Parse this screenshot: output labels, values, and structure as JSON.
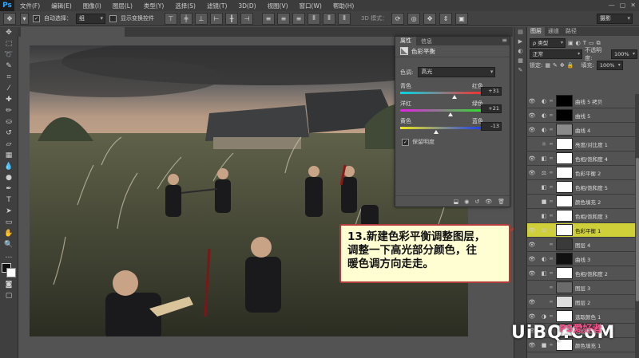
{
  "app": {
    "logo": "Ps"
  },
  "menubar": {
    "items": [
      "文件(F)",
      "编辑(E)",
      "图像(I)",
      "图层(L)",
      "类型(Y)",
      "选择(S)",
      "滤镜(T)",
      "3D(D)",
      "视图(V)",
      "窗口(W)",
      "帮助(H)"
    ],
    "win_controls": [
      "—",
      "▢",
      "✕"
    ]
  },
  "options": {
    "auto_select_label": "自动选择：",
    "auto_select_value": "组",
    "show_transform_label": "显示变换控件",
    "mode_3d_label": "3D 模式：",
    "workspace": "摄影"
  },
  "properties_panel": {
    "tabs": [
      "属性",
      "信息"
    ],
    "title": "色彩平衡",
    "tone_label": "色调:",
    "tone_value": "高光",
    "sliders": [
      {
        "left": "青色",
        "right": "红色",
        "value": "+31",
        "level": 0.655
      },
      {
        "left": "洋红",
        "right": "绿色",
        "value": "+21",
        "level": 0.605
      },
      {
        "left": "黄色",
        "right": "蓝色",
        "value": "-13",
        "level": 0.435
      }
    ],
    "preserve_label": "保留明度",
    "preserve_checked": "✓"
  },
  "layers_panel": {
    "tabs": [
      "图层",
      "通道",
      "路径"
    ],
    "filter_kind": "ρ 类型",
    "blend_mode": "正常",
    "opacity_label": "不透明度:",
    "opacity_value": "100%",
    "lock_label": "锁定:",
    "fill_label": "填充:",
    "fill_value": "100%",
    "layers": [
      {
        "name": "曲线 5 拷贝",
        "visible": true,
        "thumb": "#000000",
        "adj": "◐"
      },
      {
        "name": "曲线 5",
        "visible": true,
        "thumb": "#000000",
        "adj": "◐"
      },
      {
        "name": "曲线 4",
        "visible": true,
        "thumb": "#8a8a8a",
        "adj": "◐"
      },
      {
        "name": "亮度/对比度 1",
        "visible": false,
        "thumb": "#ffffff",
        "adj": "☼"
      },
      {
        "name": "色相/饱和度 4",
        "visible": true,
        "thumb": "#ffffff",
        "adj": "◧"
      },
      {
        "name": "色彩平衡 2",
        "visible": true,
        "thumb": "#ffffff",
        "adj": "⚖"
      },
      {
        "name": "色相/饱和度 5",
        "visible": false,
        "thumb": "#ffffff",
        "adj": "◧"
      },
      {
        "name": "颜色填充 2",
        "visible": false,
        "thumb": "#ffffff",
        "adj": "■"
      },
      {
        "name": "色相/饱和度 3",
        "visible": false,
        "thumb": "#ffffff",
        "adj": "◧"
      },
      {
        "name": "色彩平衡 1",
        "visible": true,
        "thumb": "#ffffff",
        "adj": "⚖",
        "selected": true
      },
      {
        "name": "图层 4",
        "visible": true,
        "thumb": "#3a3a3a",
        "adj": ""
      },
      {
        "name": "曲线 3",
        "visible": true,
        "thumb": "#111111",
        "adj": "◐"
      },
      {
        "name": "色相/饱和度 2",
        "visible": true,
        "thumb": "#ffffff",
        "adj": "◧"
      },
      {
        "name": "图层 3",
        "visible": false,
        "thumb": "#6b6b6b",
        "adj": ""
      },
      {
        "name": "图层 2",
        "visible": true,
        "thumb": "#dddddd",
        "adj": ""
      },
      {
        "name": "选取颜色 1",
        "visible": true,
        "thumb": "#ffffff",
        "adj": "◑"
      },
      {
        "name": "色相/饱和度 1",
        "visible": true,
        "thumb": "#ffffff",
        "adj": "◧"
      },
      {
        "name": "颜色填充 1",
        "visible": true,
        "thumb": "#ffffff",
        "adj": "■"
      }
    ]
  },
  "callout": {
    "lines": [
      "13.新建色彩平衡调整图层，",
      "调整一下高光部分颜色，往",
      "暖色调方向走走。"
    ],
    "border_color": "#b23c3c"
  },
  "watermark": {
    "main": "UiBQ.CoM",
    "sub": "PS爱好者"
  }
}
